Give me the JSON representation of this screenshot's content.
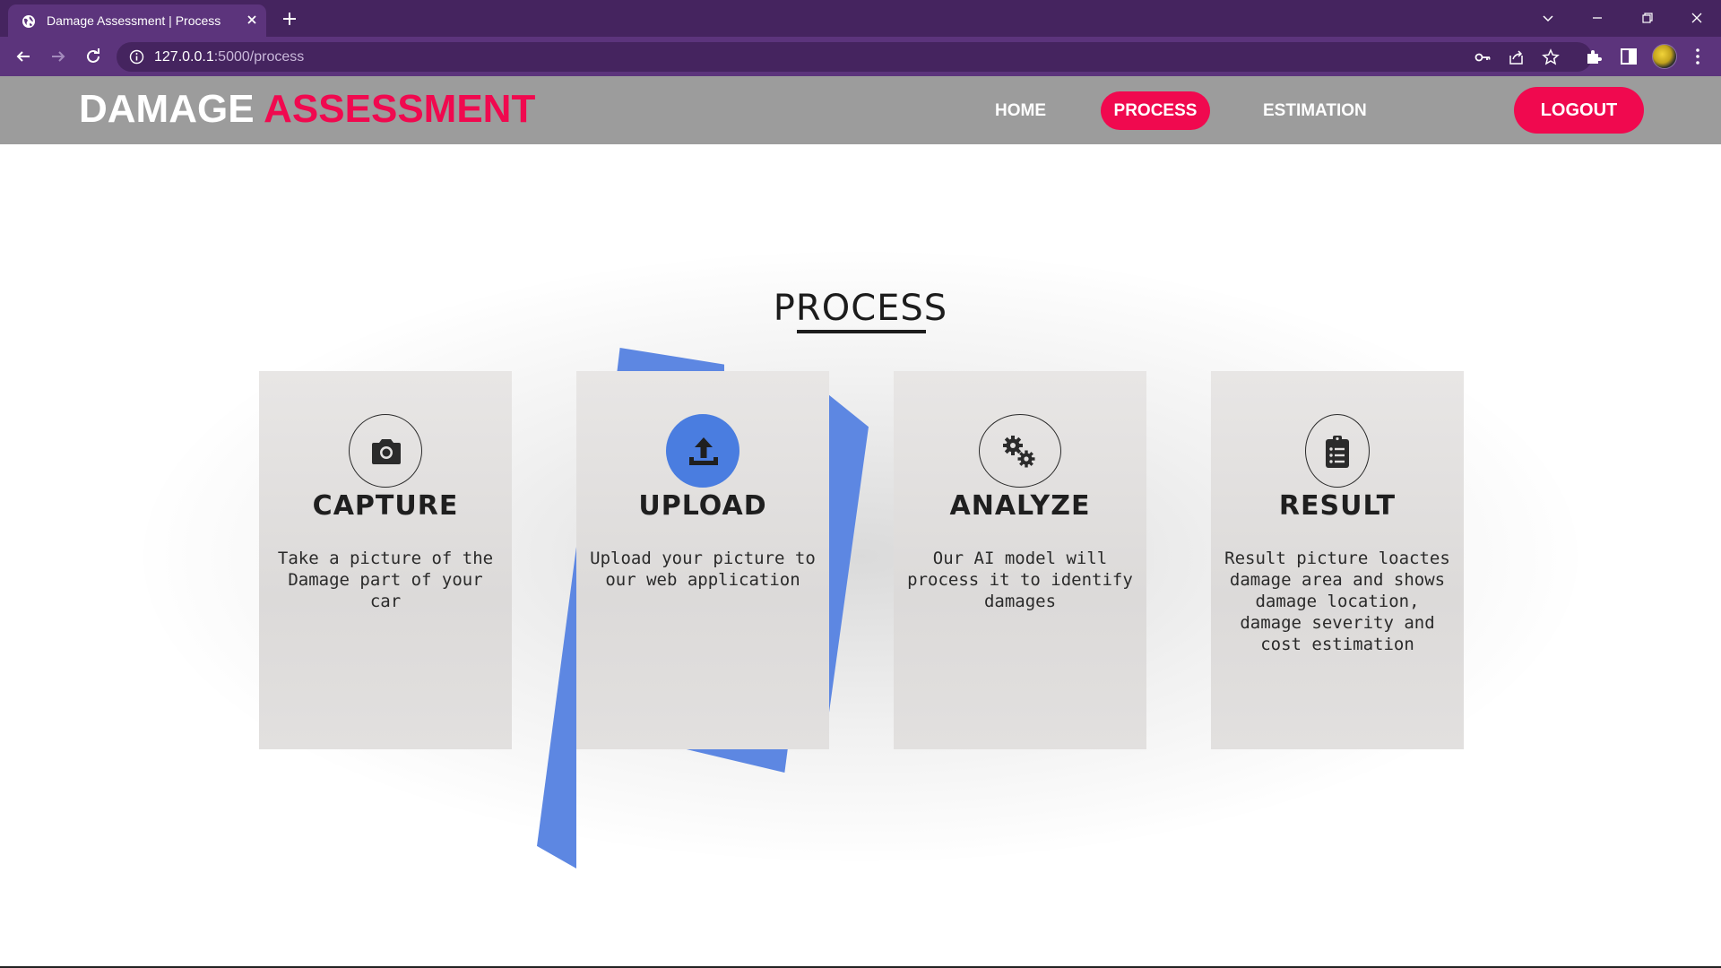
{
  "browser": {
    "tab_title": "Damage Assessment | Process",
    "url_host": "127.0.0.1",
    "url_path": ":5000/process"
  },
  "header": {
    "logo_part1": "DAMAGE",
    "logo_part2": "ASSESSMENT",
    "nav": [
      {
        "label": "HOME",
        "active": false
      },
      {
        "label": "PROCESS",
        "active": true
      },
      {
        "label": "ESTIMATION",
        "active": false
      }
    ],
    "logout_label": "LOGOUT"
  },
  "main": {
    "section_title": "PROCESS",
    "cards": [
      {
        "title": "CAPTURE",
        "icon": "camera-icon",
        "text": "Take a picture of the Damage part of your car"
      },
      {
        "title": "UPLOAD",
        "icon": "upload-icon",
        "text": "Upload your picture to our web application"
      },
      {
        "title": "ANALYZE",
        "icon": "gears-icon",
        "text": "Our AI model will process it to identify damages"
      },
      {
        "title": "RESULT",
        "icon": "clipboard-list-icon",
        "text": "Result picture loactes damage area and shows damage location, damage severity and cost estimation"
      }
    ]
  },
  "colors": {
    "accent": "#f0094f",
    "highlight_blue": "#4a7de0",
    "browser_frame": "#45245f",
    "header_bg": "#9c9c9c"
  }
}
